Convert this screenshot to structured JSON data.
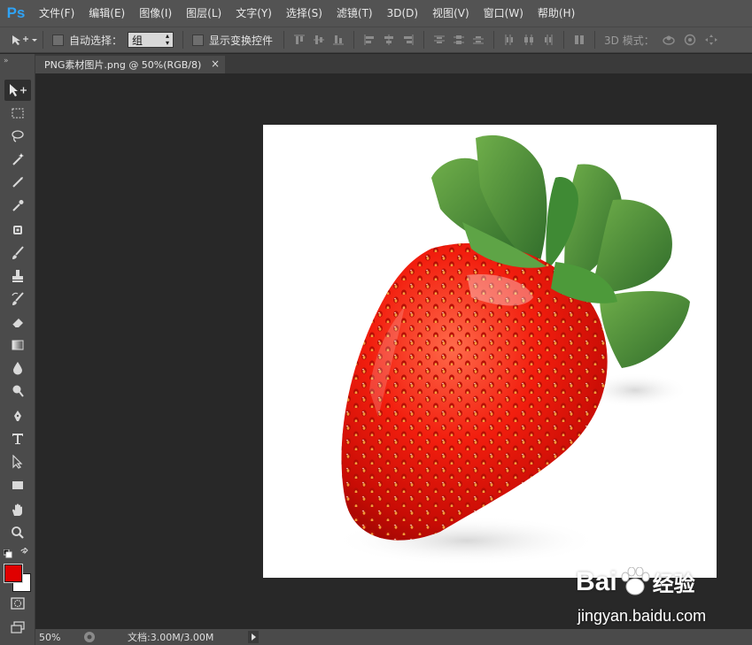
{
  "app": {
    "logo": "Ps"
  },
  "menu": [
    "文件(F)",
    "编辑(E)",
    "图像(I)",
    "图层(L)",
    "文字(Y)",
    "选择(S)",
    "滤镜(T)",
    "3D(D)",
    "视图(V)",
    "窗口(W)",
    "帮助(H)"
  ],
  "options": {
    "auto_select_label": "自动选择：",
    "auto_select_value": "组",
    "show_transform_label": "显示变换控件",
    "mode_3d_label": "3D 模式："
  },
  "document": {
    "tab_title": "PNG素材图片.png @ 50%(RGB/8)",
    "close_glyph": "×"
  },
  "status": {
    "zoom": "50%",
    "doc_size": "文档:3.00M/3.00M"
  },
  "colors": {
    "foreground": "#e00000",
    "background": "#ffffff",
    "ps_blue": "#2fa3f6"
  },
  "watermark": {
    "brand": "Bai",
    "brand_tail": "经验",
    "url": "jingyan.baidu.com"
  }
}
